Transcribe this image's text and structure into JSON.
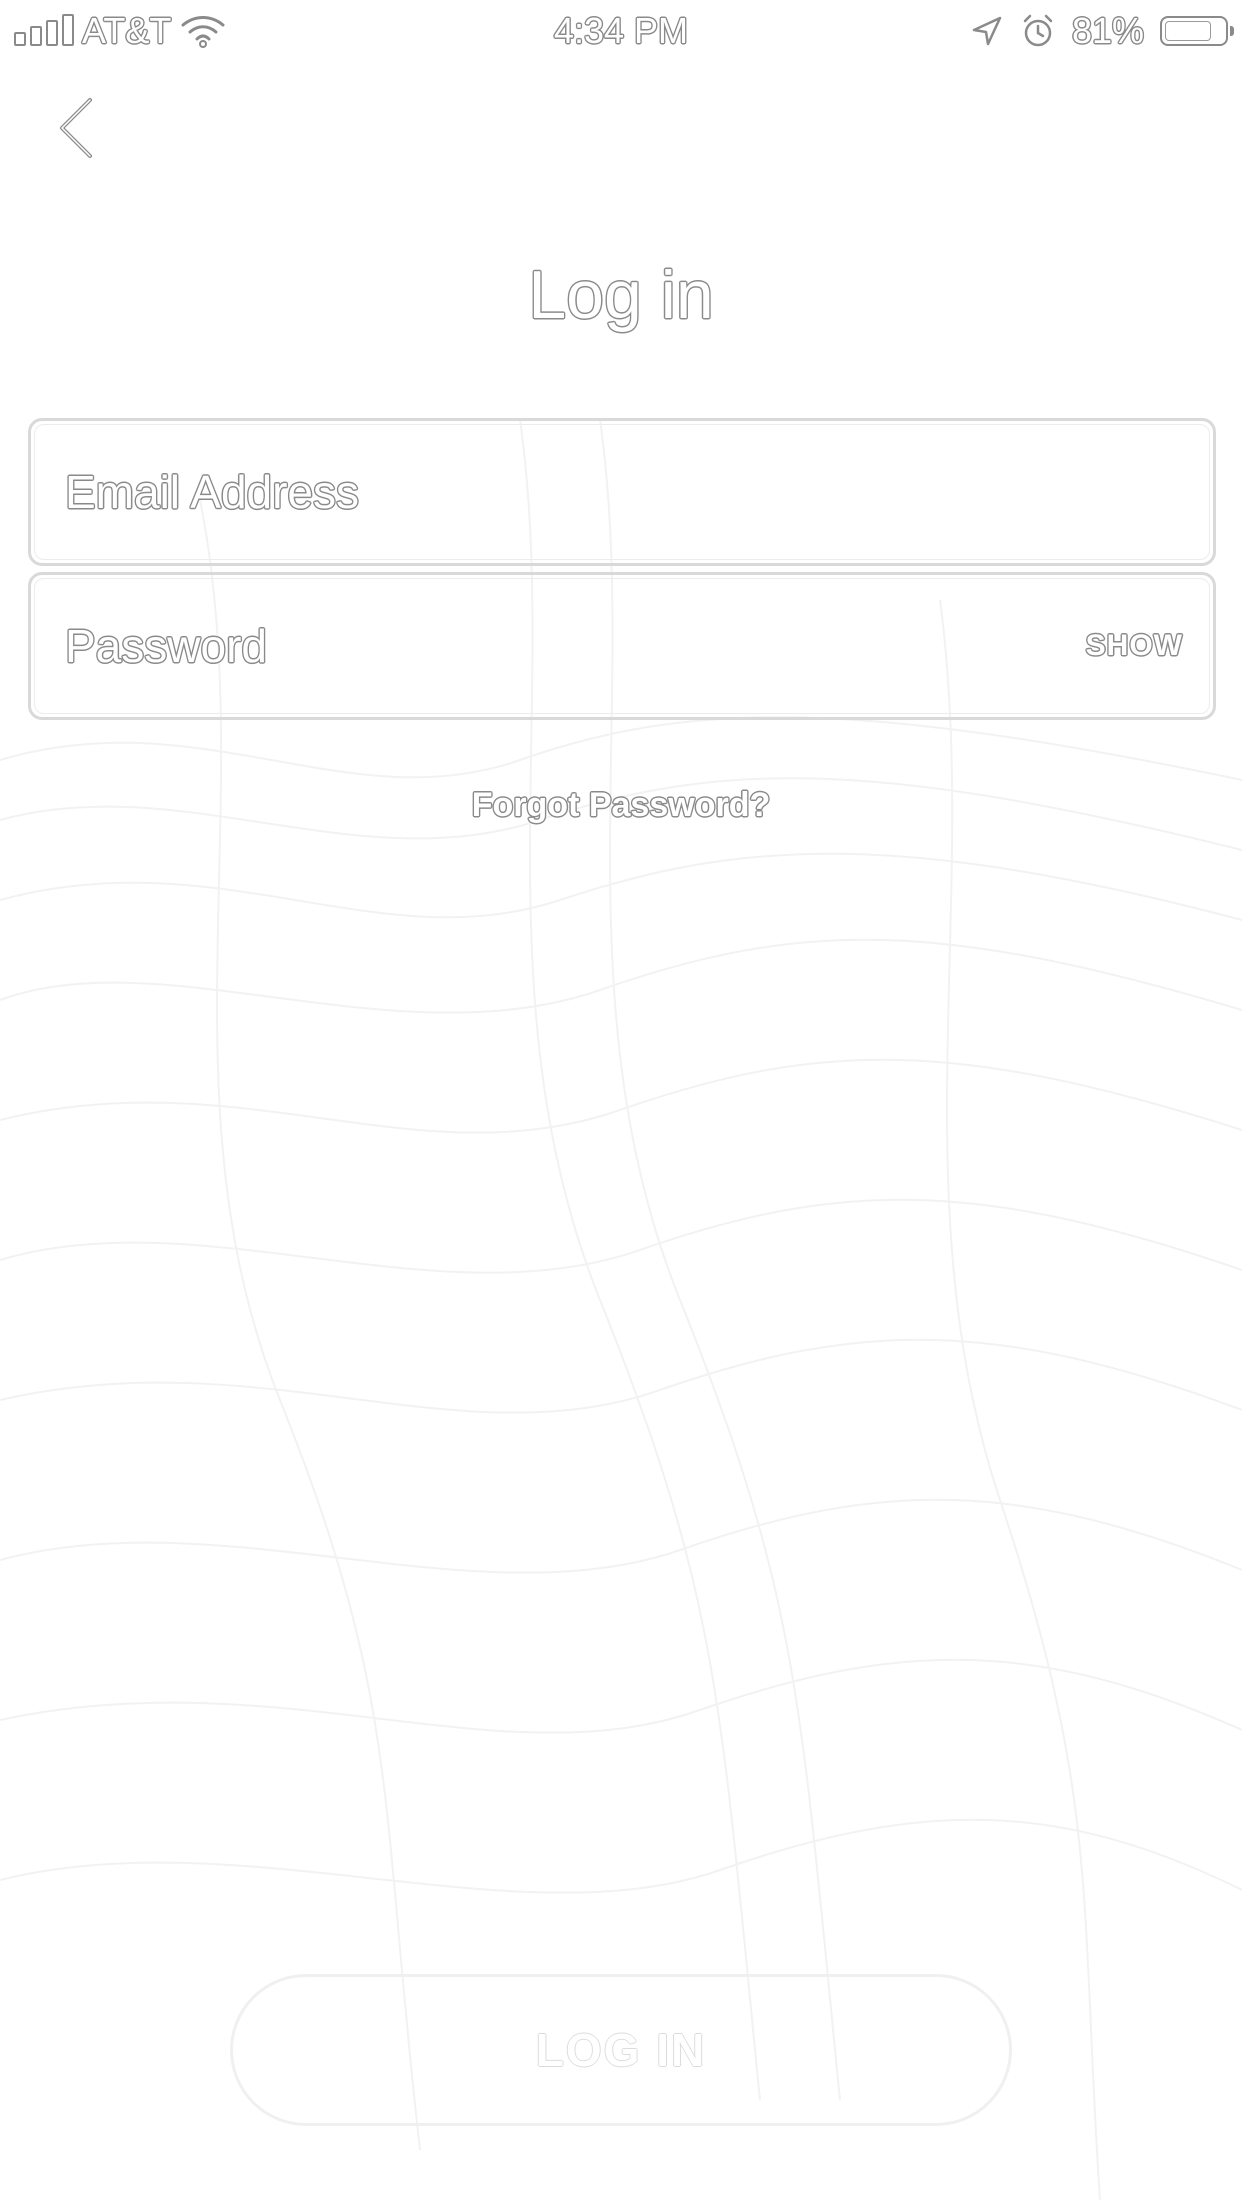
{
  "status_bar": {
    "carrier": "AT&T",
    "time": "4:34 PM",
    "battery_percent": "81%",
    "battery_level": 0.81,
    "icons": [
      "signal-icon",
      "wifi-icon",
      "location-arrow-icon",
      "alarm-icon",
      "battery-icon"
    ]
  },
  "nav": {
    "back_icon": "chevron-left-icon"
  },
  "page": {
    "title": "Log in"
  },
  "form": {
    "email": {
      "value": "",
      "placeholder": "Email Address"
    },
    "password": {
      "value": "",
      "placeholder": "Password",
      "show_label": "SHOW"
    },
    "forgot_password_label": "Forgot Password?",
    "login_button_label": "LOG IN"
  },
  "colors": {
    "background": "#ffffff",
    "outline_text": "#8a8a8a",
    "field_border": "#d9d9d9"
  }
}
